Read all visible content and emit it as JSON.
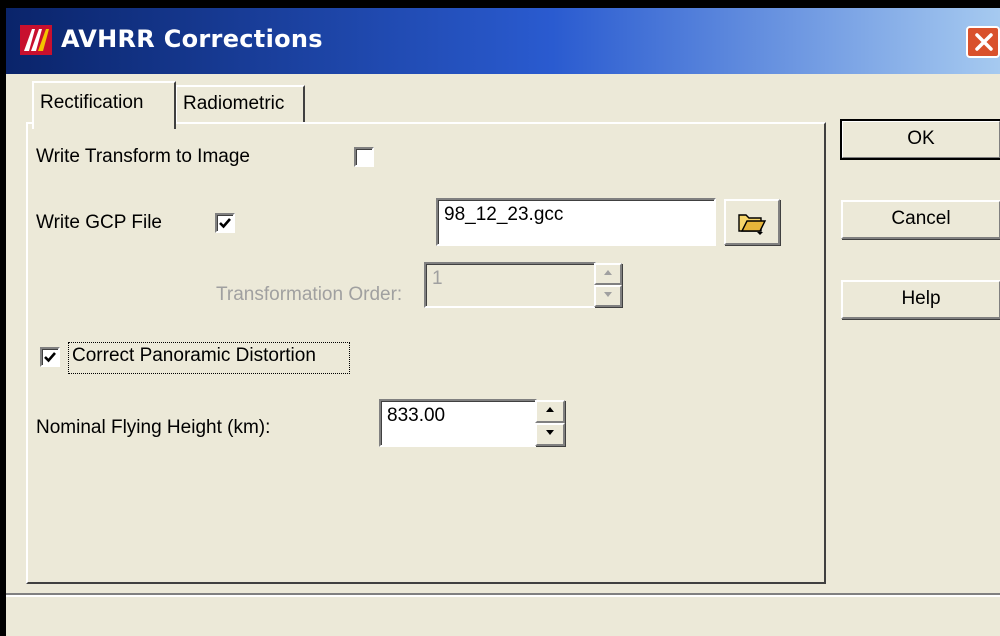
{
  "window": {
    "title": "AVHRR Corrections"
  },
  "tabs": [
    {
      "label": "Rectification",
      "active": true
    },
    {
      "label": "Radiometric",
      "active": false
    }
  ],
  "rectification": {
    "write_transform_label": "Write Transform to Image",
    "write_transform_checked": false,
    "write_gcp_label": "Write GCP File",
    "write_gcp_checked": true,
    "gcp_filename": "98_12_23.gcc",
    "transformation_order_label": "Transformation Order:",
    "transformation_order_value": "1",
    "panoramic_label": "Correct Panoramic Distortion",
    "panoramic_checked": true,
    "flying_height_label": "Nominal Flying Height (km):",
    "flying_height_value": "833.00"
  },
  "buttons": {
    "ok": "OK",
    "cancel": "Cancel",
    "help": "Help"
  },
  "icons": {
    "app": "erdas-imagine-icon",
    "close": "close-icon",
    "folder": "open-folder-icon",
    "spin_up": "chevron-up-icon",
    "spin_down": "chevron-down-icon"
  },
  "colors": {
    "title_gradient_start": "#0a246a",
    "title_gradient_end": "#a6caf0",
    "close_button": "#d9512c",
    "dialog_face": "#ece9d8",
    "disabled_text": "#a0a0a0"
  }
}
